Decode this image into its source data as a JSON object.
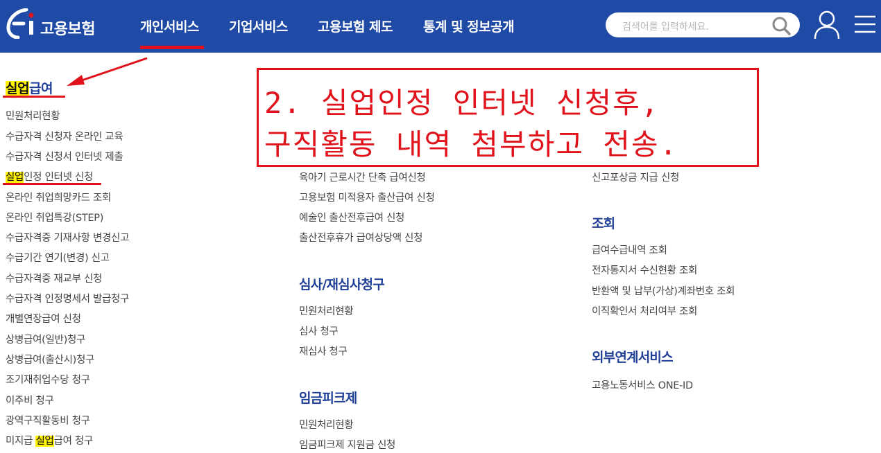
{
  "header": {
    "logo_text": "고용보험",
    "nav": [
      {
        "label": "개인서비스",
        "active": true
      },
      {
        "label": "기업서비스"
      },
      {
        "label": "고용보험 제도"
      },
      {
        "label": "통계 및 정보공개"
      }
    ],
    "search_placeholder": "검색어를 입력하세요.",
    "colors": {
      "header_bg": "#1f4aa6",
      "accent_red": "#e0121b",
      "highlight": "#fff200"
    }
  },
  "left_column": {
    "title_hl": "실업",
    "title_rest": "급여",
    "items": [
      "민원처리현황",
      "수급자격 신청자 온라인 교육",
      "수급자격 신청서 인터넷 제출",
      {
        "hl": "실업",
        "rest": "인정 인터넷 신청"
      },
      "온라인 취업희망카드 조회",
      "온라인 취업특강(STEP)",
      "수급자격증 기재사항 변경신고",
      "수급기간 연기(변경) 신고",
      "수급자격증 재교부 신청",
      "수급자격 인정명세서 발급청구",
      "개별연장급여 신청",
      "상병급여(일반)청구",
      "상병급여(출산시)청구",
      "조기재취업수당 청구",
      "이주비 청구",
      "광역구직활동비 청구",
      {
        "pre": "미지급 ",
        "hl": "실업",
        "rest": "급여 청구"
      }
    ]
  },
  "middle_column": {
    "top_items": [
      "육아기 근로시간 단축 급여신청",
      "고용보험 미적용자 출산급여 신청",
      "예술인 출산전후급여 신청",
      "출산전후휴가 급여상당액 신청"
    ],
    "sections": [
      {
        "title": "심사/재심사청구",
        "items": [
          "민원처리현황",
          "심사 청구",
          "재심사 청구"
        ]
      },
      {
        "title": "임금피크제",
        "items": [
          "민원처리현황",
          "임금피크제 지원금 신청"
        ]
      }
    ]
  },
  "right_column": {
    "top_items": [
      "신고포상금 지급 신청"
    ],
    "sections": [
      {
        "title": "조회",
        "items": [
          "급여수급내역 조회",
          "전자통지서 수신현황 조회",
          "반환액 및 납부(가상)계좌번호 조회",
          "이직확인서 처리여부 조회"
        ]
      },
      {
        "title": "외부연계서비스",
        "items": [
          "고용노동서비스 ONE-ID"
        ]
      }
    ]
  },
  "annotation": {
    "line1": "2. 실업인정 인터넷 신청후,",
    "line2": "구직활동 내역 첨부하고 전송."
  }
}
